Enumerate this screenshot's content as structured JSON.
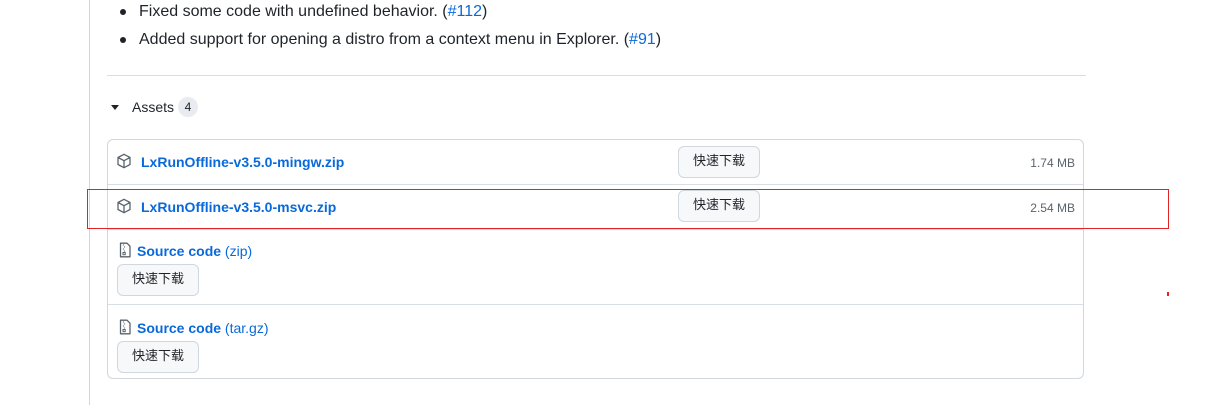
{
  "release_notes": [
    {
      "text": "Fixed some code with undefined behavior. (",
      "link": "#112",
      "after": ")"
    },
    {
      "text": "Added support for opening a distro from a context menu in Explorer. (",
      "link": "#91",
      "after": ")"
    }
  ],
  "assets": {
    "title": "Assets",
    "count": "4",
    "items": [
      {
        "name": "LxRunOffline-v3.5.0-mingw.zip",
        "button": "快速下载",
        "size": "1.74 MB",
        "icon": "package-icon"
      },
      {
        "name": "LxRunOffline-v3.5.0-msvc.zip",
        "button": "快速下载",
        "size": "2.54 MB",
        "icon": "package-icon",
        "highlighted": true
      },
      {
        "name": "Source code",
        "suffix": "(zip)",
        "button": "快速下载",
        "icon": "file-zip-icon"
      },
      {
        "name": "Source code",
        "suffix": "(tar.gz)",
        "button": "快速下载",
        "icon": "file-zip-icon"
      }
    ]
  },
  "colors": {
    "link": "#0969da",
    "highlight": "#e02424",
    "border": "#d0d7de"
  }
}
